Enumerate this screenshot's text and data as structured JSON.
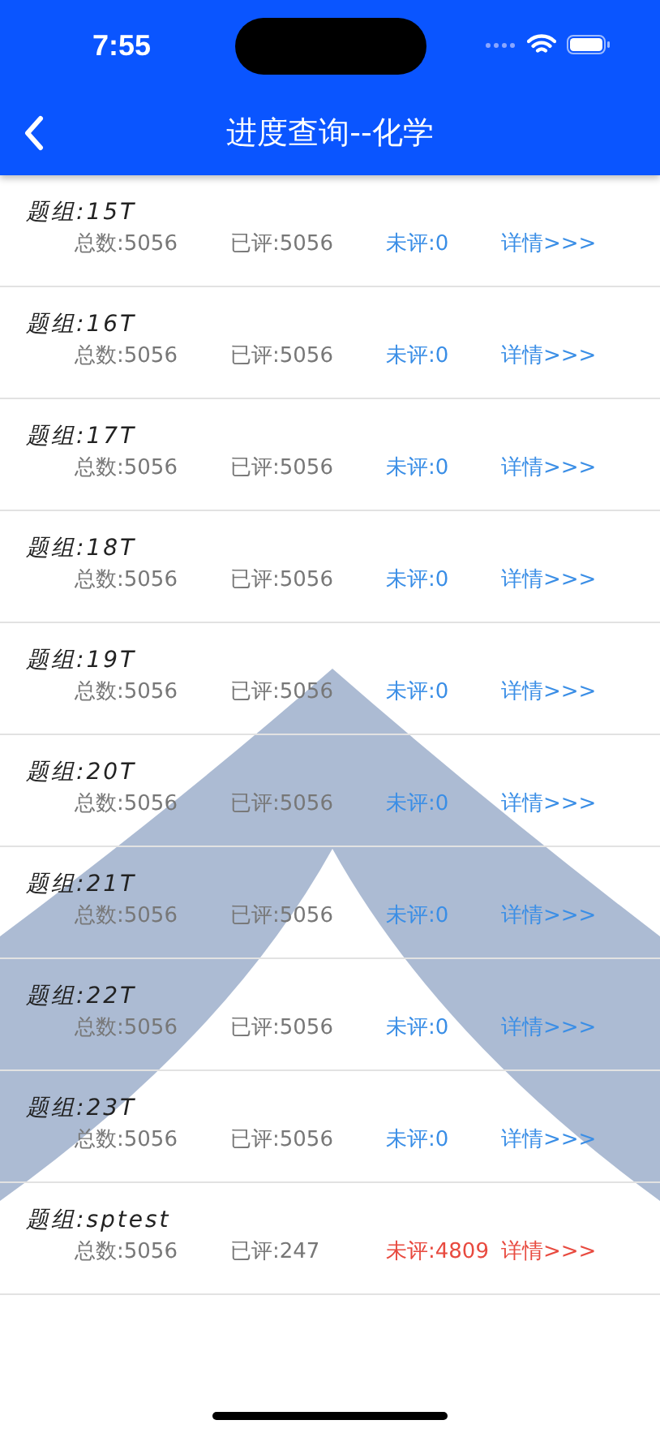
{
  "status_bar": {
    "time": "7:55"
  },
  "nav": {
    "title": "进度查询--化学"
  },
  "groups": [
    {
      "title": "题组:15T",
      "total": "总数:5056",
      "graded": "已评:5056",
      "pending": "未评:0",
      "details": "详情>>>",
      "color": "#3a8ee6"
    },
    {
      "title": "题组:16T",
      "total": "总数:5056",
      "graded": "已评:5056",
      "pending": "未评:0",
      "details": "详情>>>",
      "color": "#3a8ee6"
    },
    {
      "title": "题组:17T",
      "total": "总数:5056",
      "graded": "已评:5056",
      "pending": "未评:0",
      "details": "详情>>>",
      "color": "#3a8ee6"
    },
    {
      "title": "题组:18T",
      "total": "总数:5056",
      "graded": "已评:5056",
      "pending": "未评:0",
      "details": "详情>>>",
      "color": "#3a8ee6"
    },
    {
      "title": "题组:19T",
      "total": "总数:5056",
      "graded": "已评:5056",
      "pending": "未评:0",
      "details": "详情>>>",
      "color": "#3a8ee6"
    },
    {
      "title": "题组:20T",
      "total": "总数:5056",
      "graded": "已评:5056",
      "pending": "未评:0",
      "details": "详情>>>",
      "color": "#3a8ee6"
    },
    {
      "title": "题组:21T",
      "total": "总数:5056",
      "graded": "已评:5056",
      "pending": "未评:0",
      "details": "详情>>>",
      "color": "#3a8ee6"
    },
    {
      "title": "题组:22T",
      "total": "总数:5056",
      "graded": "已评:5056",
      "pending": "未评:0",
      "details": "详情>>>",
      "color": "#3a8ee6"
    },
    {
      "title": "题组:23T",
      "total": "总数:5056",
      "graded": "已评:5056",
      "pending": "未评:0",
      "details": "详情>>>",
      "color": "#3a8ee6"
    },
    {
      "title": "题组:sptest",
      "total": "总数:5056",
      "graded": "已评:247",
      "pending": "未评:4809",
      "details": "详情>>>",
      "color": "#e84a3f"
    }
  ]
}
